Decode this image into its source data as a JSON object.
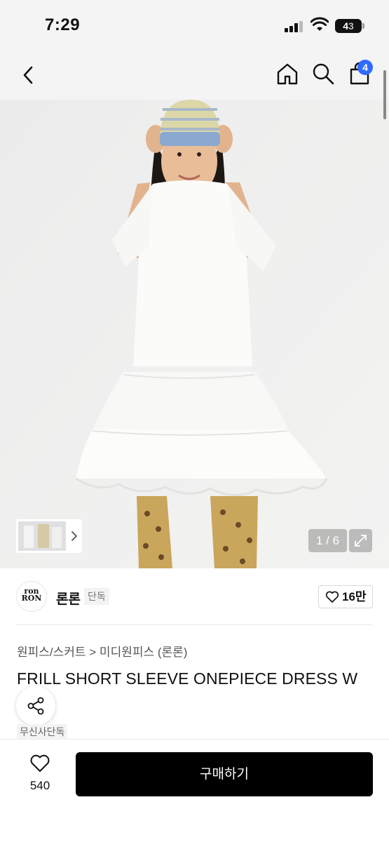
{
  "status_bar": {
    "time": "7:29",
    "battery_level": "43",
    "battery_lead": "4",
    "battery_tail": "3"
  },
  "nav": {
    "cart_count": "4"
  },
  "gallery": {
    "counter": "1 / 6",
    "current_index": 1,
    "total": 6
  },
  "brand": {
    "logo_text_line1": "ron",
    "logo_text_line2": "RON",
    "name": "론론",
    "tag": "단독",
    "likes": "16만"
  },
  "product": {
    "category": "원피스/스커트 > 미디원피스 (론론)",
    "title": "FRILL SHORT SLEEVE ONEPIECE DRESS W",
    "exclusive_tag": "무신사단독"
  },
  "bottom_bar": {
    "wish_count": "540",
    "buy_label": "구매하기"
  },
  "colors": {
    "accent_badge": "#2f6bff",
    "buy_button": "#000000",
    "nav_bg": "#f4f4f4"
  }
}
